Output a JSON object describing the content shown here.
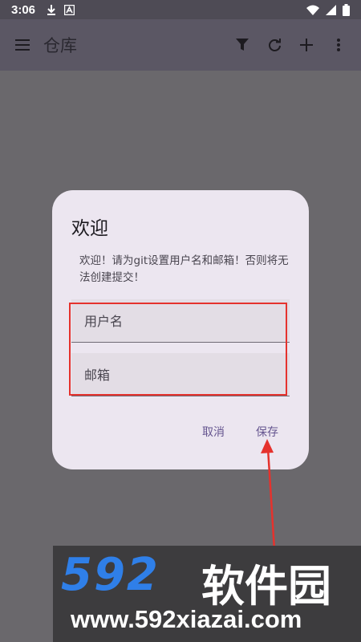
{
  "status_bar": {
    "time": "3:06"
  },
  "app_bar": {
    "title": "仓库"
  },
  "dialog": {
    "title": "欢迎",
    "message": "欢迎！请为git设置用户名和邮箱！否则将无法创建提交！",
    "username_label": "用户名",
    "email_label": "邮箱",
    "cancel_label": "取消",
    "save_label": "保存"
  },
  "watermark": {
    "brand_num": "592",
    "brand_text": "软件园",
    "url": "www.592xiazai.com"
  },
  "colors": {
    "accent": "#65558f",
    "highlight": "#e5322d",
    "brand": "#2f7fe8"
  }
}
